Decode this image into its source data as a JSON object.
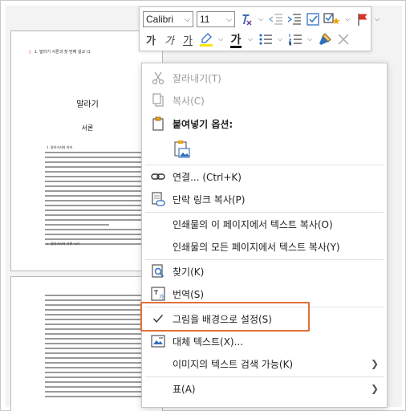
{
  "document": {
    "header_mark": "▯",
    "header_text": "1. 말라기 서론과 첫 번째 설교 (1",
    "title": "말라기",
    "subtitle": "서론",
    "heading_1": "1. 말라기서의 저자",
    "heading_2": "2. 말라기서가 기록 시기"
  },
  "toolbar": {
    "font_name": "Calibri",
    "font_size": "11",
    "bold_label": "가",
    "italic_label": "가",
    "underline_label": "가",
    "highlight_color": "#f5e50a",
    "font_color": "#111111"
  },
  "context_menu": {
    "items": [
      {
        "label": "잘라내기(T)",
        "icon": "scissors-icon",
        "enabled": false
      },
      {
        "label": "복사(C)",
        "icon": "copy-icon",
        "enabled": false
      },
      {
        "label": "붙여넣기 옵션:",
        "icon": "clipboard-icon",
        "enabled": true
      },
      {
        "label": "연결...  (Ctrl+K)",
        "icon": "link-icon",
        "enabled": true
      },
      {
        "label": "단락 링크 복사(P)",
        "icon": "paragraph-link-icon",
        "enabled": true
      },
      {
        "label": "인쇄물의 이 페이지에서 텍스트 복사(O)",
        "icon": "",
        "enabled": true
      },
      {
        "label": "인쇄물의 모든 페이지에서 텍스트 복사(Y)",
        "icon": "",
        "enabled": true
      },
      {
        "label": "찾기(K)",
        "icon": "find-icon",
        "enabled": true
      },
      {
        "label": "번역(S)",
        "icon": "translate-icon",
        "enabled": true
      },
      {
        "label": "그림을 배경으로 설정(S)",
        "icon": "checkmark-icon",
        "enabled": true,
        "checked": true
      },
      {
        "label": "대체 텍스트(X)...",
        "icon": "alt-text-icon",
        "enabled": true
      },
      {
        "label": "이미지의 텍스트 검색 가능(K)",
        "icon": "",
        "enabled": true
      },
      {
        "label": "표(A)",
        "icon": "",
        "enabled": true
      }
    ]
  },
  "colors": {
    "highlight_border": "#e0703a",
    "flag_red": "#d9342b",
    "link_blue": "#2f6fbf"
  }
}
